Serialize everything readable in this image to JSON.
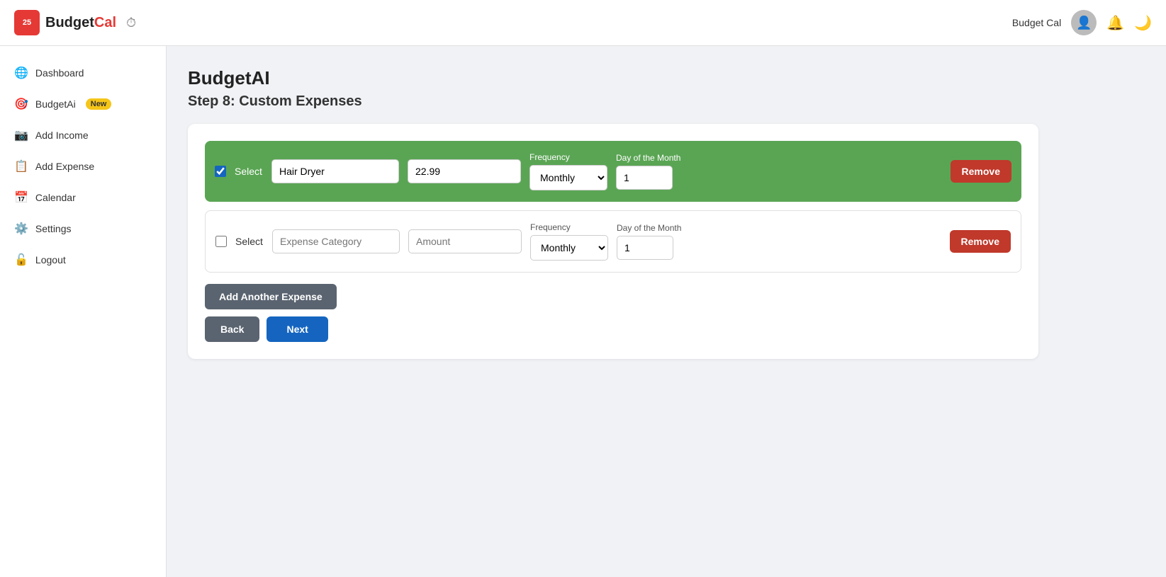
{
  "header": {
    "logo_text_black": "Budget",
    "logo_text_red": "Cal",
    "logo_icon_text": "25",
    "username": "Budget Cal",
    "clock_icon": "⏱",
    "bell_icon": "🔔",
    "moon_icon": "🌙"
  },
  "sidebar": {
    "items": [
      {
        "id": "dashboard",
        "icon": "🌐",
        "label": "Dashboard"
      },
      {
        "id": "budgetai",
        "icon": "🎯",
        "label": "BudgetAi",
        "badge": "New"
      },
      {
        "id": "add-income",
        "icon": "📷",
        "label": "Add Income"
      },
      {
        "id": "add-expense",
        "icon": "📋",
        "label": "Add Expense"
      },
      {
        "id": "calendar",
        "icon": "📅",
        "label": "Calendar"
      },
      {
        "id": "settings",
        "icon": "⚙️",
        "label": "Settings"
      },
      {
        "id": "logout",
        "icon": "🔓",
        "label": "Logout"
      }
    ]
  },
  "main": {
    "page_title": "BudgetAI",
    "step_title": "Step 8: Custom Expenses",
    "expense_rows": [
      {
        "checked": true,
        "select_label": "Select",
        "category_value": "Hair Dryer",
        "category_placeholder": "",
        "amount_value": "22.99",
        "amount_placeholder": "",
        "frequency_label": "Frequency",
        "frequency_value": "Monthly",
        "day_label": "Day of the Month",
        "day_value": "1",
        "remove_label": "Remove",
        "highlighted": true
      },
      {
        "checked": false,
        "select_label": "Select",
        "category_value": "",
        "category_placeholder": "Expense Category",
        "amount_value": "",
        "amount_placeholder": "Amount",
        "frequency_label": "Frequency",
        "frequency_value": "Monthly",
        "day_label": "Day of the Month",
        "day_value": "1",
        "remove_label": "Remove",
        "highlighted": false
      }
    ],
    "add_expense_label": "Add Another Expense",
    "back_label": "Back",
    "next_label": "Next"
  }
}
